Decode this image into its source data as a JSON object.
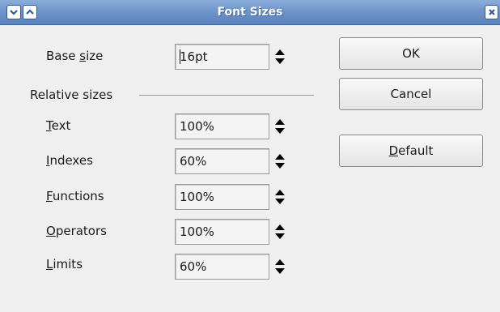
{
  "window": {
    "title": "Font Sizes"
  },
  "base_size": {
    "label_prefix": "Base ",
    "label_accel": "s",
    "label_suffix": "ize",
    "value": "16pt"
  },
  "relative_sizes": {
    "group_label": "Relative sizes",
    "fields": [
      {
        "label_accel": "T",
        "label_rest": "ext",
        "value": "100%"
      },
      {
        "label_accel": "I",
        "label_rest": "ndexes",
        "value": "60%"
      },
      {
        "label_accel": "F",
        "label_rest": "unctions",
        "value": "100%"
      },
      {
        "label_accel": "O",
        "label_rest": "perators",
        "value": "100%"
      },
      {
        "label_accel": "L",
        "label_rest": "imits",
        "value": "60%"
      }
    ]
  },
  "buttons": {
    "ok": "OK",
    "cancel": "Cancel",
    "default_accel": "D",
    "default_rest": "efault"
  },
  "icons": {
    "menu": "chevron-down-icon",
    "shade": "chevron-up-icon",
    "close": "close-icon",
    "spin": "spin-arrows-icon"
  }
}
